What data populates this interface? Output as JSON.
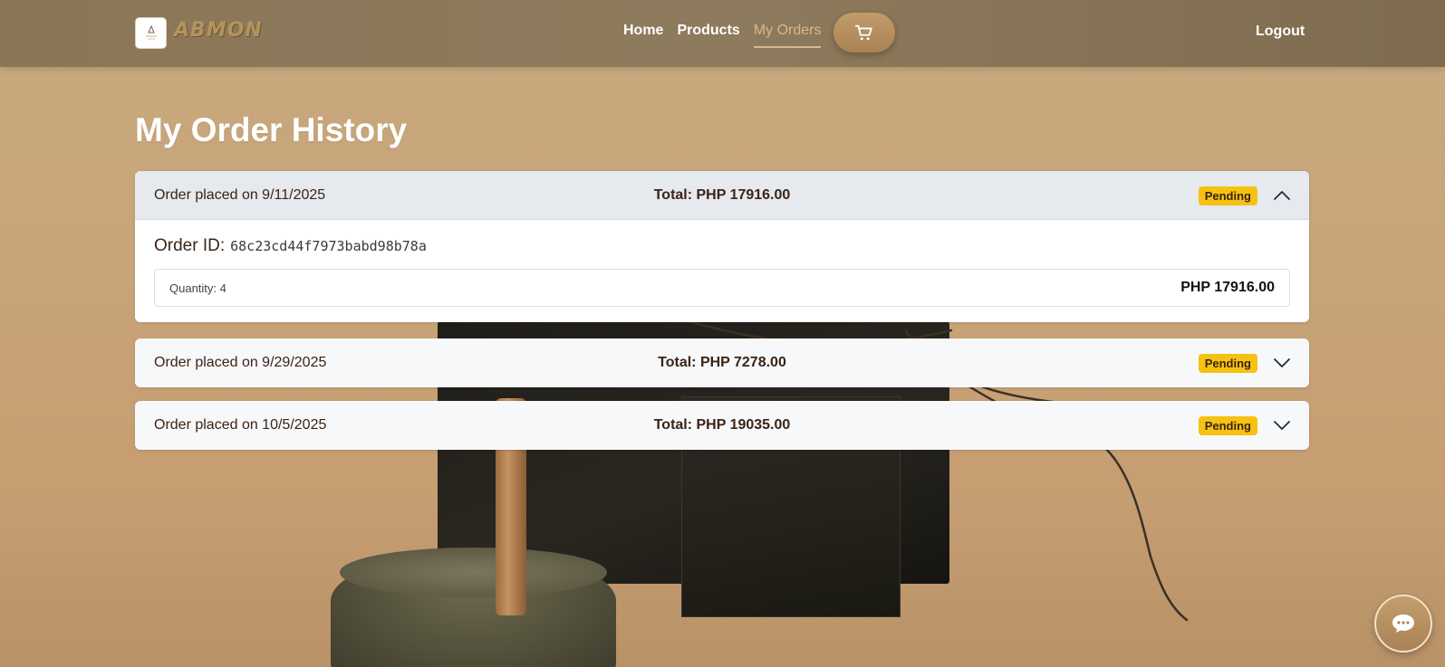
{
  "nav": {
    "brand": "ABMON",
    "links": [
      {
        "label": "Home"
      },
      {
        "label": "Products"
      },
      {
        "label": "My Orders"
      }
    ],
    "cart_icon": "cart-icon",
    "logout_label": "Logout"
  },
  "page": {
    "title": "My Order History"
  },
  "orders": [
    {
      "date_label": "Order placed on 9/11/2025",
      "total_label": "Total: PHP 17916.00",
      "status": "Pending",
      "expanded": true,
      "order_id_label": "Order ID:",
      "order_id": "68c23cd44f7973babd98b78a",
      "items": [
        {
          "quantity_label": "Quantity: 4",
          "price_label": "PHP 17916.00"
        }
      ]
    },
    {
      "date_label": "Order placed on 9/29/2025",
      "total_label": "Total: PHP 7278.00",
      "status": "Pending",
      "expanded": false
    },
    {
      "date_label": "Order placed on 10/5/2025",
      "total_label": "Total: PHP 19035.00",
      "status": "Pending",
      "expanded": false
    }
  ],
  "chat": {
    "icon": "chat-bubble-icon"
  },
  "colors": {
    "navbar": "#8b7658",
    "accent": "#c19b6a",
    "status_pending": "#f5c211",
    "text_dark": "#3b2416"
  }
}
